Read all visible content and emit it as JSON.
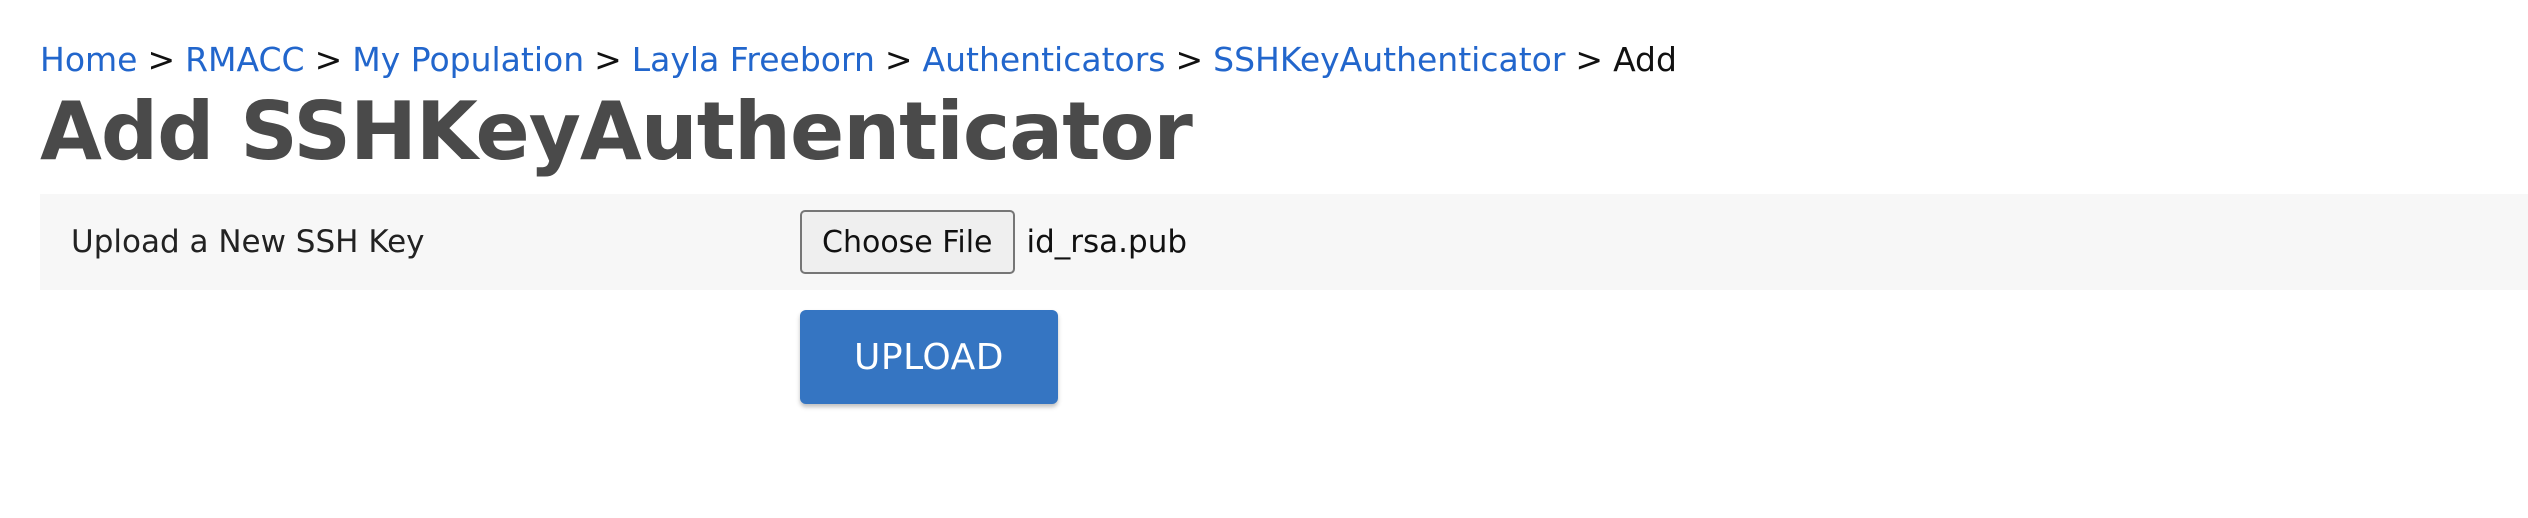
{
  "breadcrumb": {
    "items": [
      {
        "label": "Home"
      },
      {
        "label": "RMACC"
      },
      {
        "label": "My Population"
      },
      {
        "label": "Layla Freeborn"
      },
      {
        "label": "Authenticators"
      },
      {
        "label": "SSHKeyAuthenticator"
      }
    ],
    "current": "Add",
    "separator": ">"
  },
  "page": {
    "title": "Add SSHKeyAuthenticator"
  },
  "form": {
    "upload_label": "Upload a New SSH Key",
    "choose_file_label": "Choose File",
    "selected_file": "id_rsa.pub",
    "submit_label": "UPLOAD"
  },
  "colors": {
    "link": "#2266cc",
    "title": "#4a4a4a",
    "row_background": "#f7f7f7",
    "primary_button": "#3575c2"
  }
}
